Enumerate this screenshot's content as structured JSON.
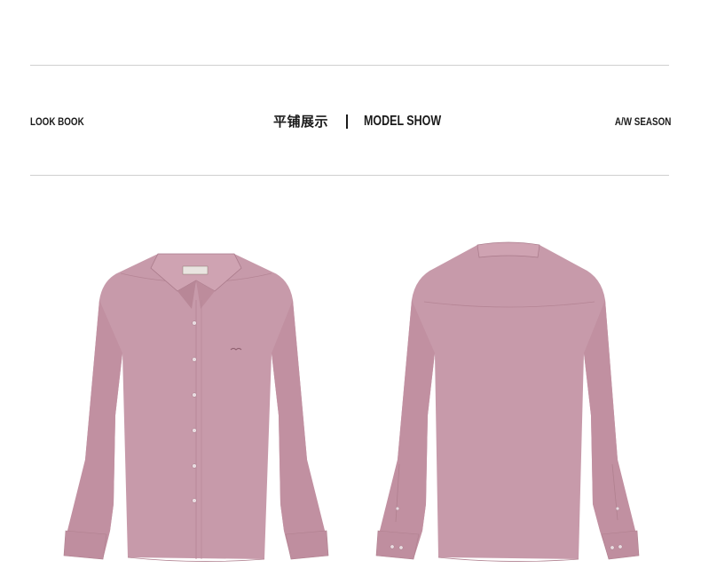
{
  "header": {
    "left_label": "LOOK BOOK",
    "center_cn": "平铺展示",
    "center_en": "MODEL SHOW",
    "right_label": "A/W SEASON"
  },
  "colors": {
    "shirt": "#c79aaa",
    "shirt_shadow": "#b0808f",
    "shirt_light": "#d4abb8",
    "rule": "#cfcfcf",
    "text": "#1a1a1a"
  },
  "products": [
    {
      "view": "front",
      "icon": "shirt-front-image"
    },
    {
      "view": "back",
      "icon": "shirt-back-image"
    }
  ]
}
